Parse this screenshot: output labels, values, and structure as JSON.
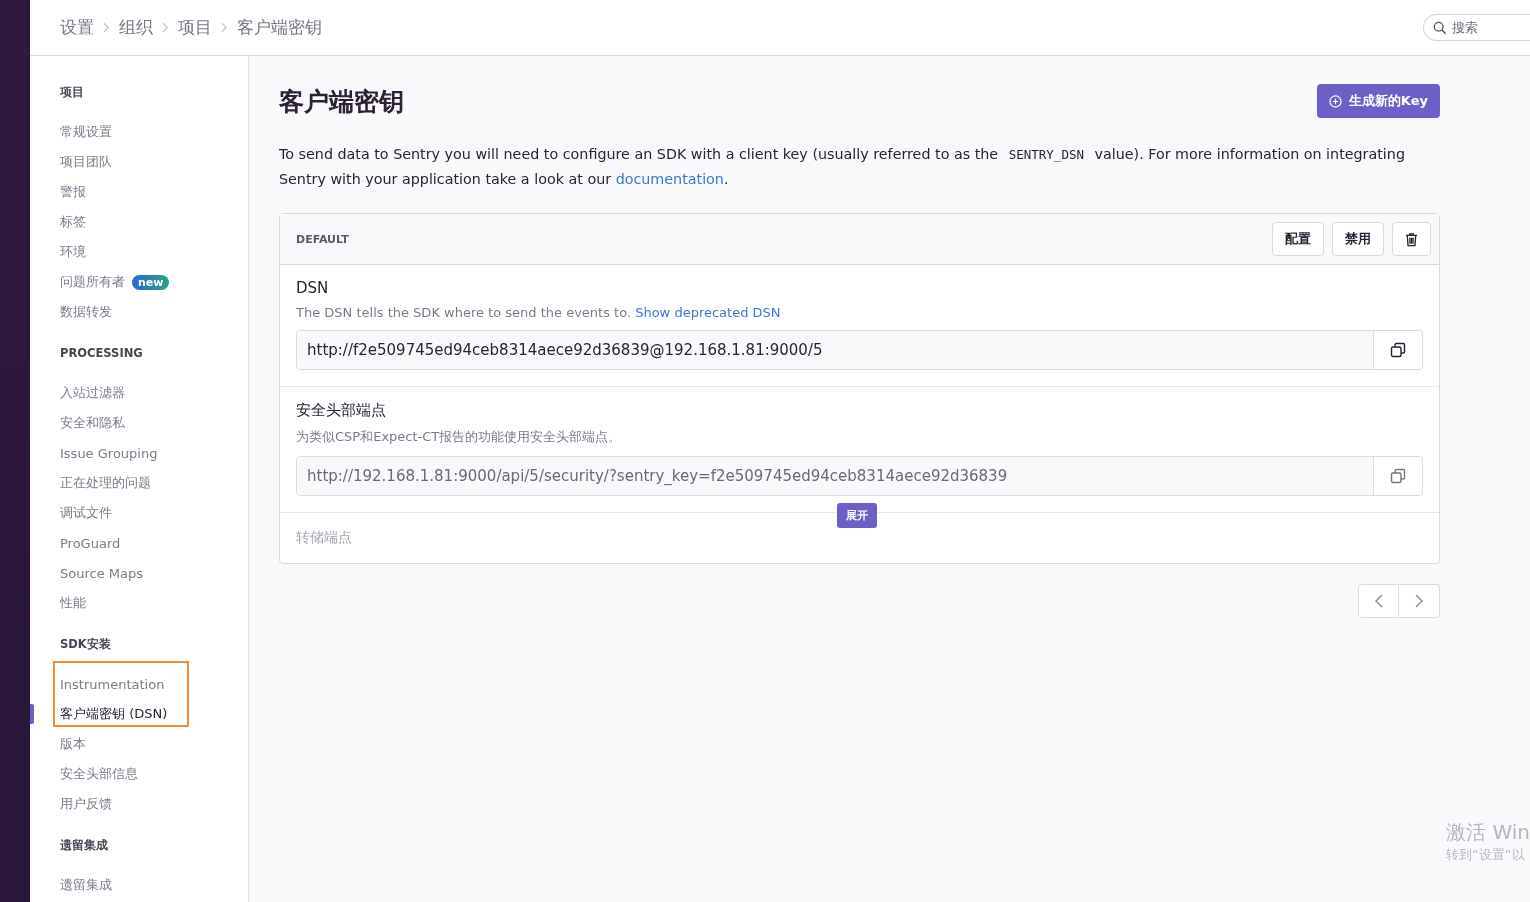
{
  "breadcrumbs": [
    "设置",
    "组织",
    "项目",
    "客户端密钥"
  ],
  "search": {
    "placeholder": "搜索"
  },
  "sidebar": [
    {
      "heading": "项目",
      "items": [
        {
          "label": "常规设置",
          "selected": false
        },
        {
          "label": "项目团队",
          "selected": false
        },
        {
          "label": "警报",
          "selected": false
        },
        {
          "label": "标签",
          "selected": false
        },
        {
          "label": "环境",
          "selected": false
        },
        {
          "label": "问题所有者",
          "selected": false,
          "badge": "new"
        },
        {
          "label": "数据转发",
          "selected": false
        }
      ]
    },
    {
      "heading": "PROCESSING",
      "items": [
        {
          "label": "入站过滤器",
          "selected": false
        },
        {
          "label": "安全和隐私",
          "selected": false
        },
        {
          "label": "Issue Grouping",
          "selected": false
        },
        {
          "label": "正在处理的问题",
          "selected": false
        },
        {
          "label": "调试文件",
          "selected": false
        },
        {
          "label": "ProGuard",
          "selected": false
        },
        {
          "label": "Source Maps",
          "selected": false
        },
        {
          "label": "性能",
          "selected": false
        }
      ]
    },
    {
      "heading": "SDK安装",
      "items": [
        {
          "label": "Instrumentation",
          "selected": false,
          "outlined": true
        },
        {
          "label": "客户端密钥 (DSN)",
          "selected": true,
          "outlined": true
        },
        {
          "label": "版本",
          "selected": false,
          "outlined": false
        },
        {
          "label": "安全头部信息",
          "selected": false,
          "outlined": false
        },
        {
          "label": "用户反馈",
          "selected": false,
          "outlined": false
        }
      ]
    },
    {
      "heading": "遗留集成",
      "items": [
        {
          "label": "遗留集成",
          "selected": false
        }
      ]
    }
  ],
  "page": {
    "title": "客户端密钥",
    "new_key_button": "生成新的Key",
    "intro": "To send data to Sentry you will need to configure an SDK with a client key (usually referred to as the ",
    "intro_code": "SENTRY_DSN",
    "intro_mid": " value). For more information on integrating Sentry with your application take a look at our ",
    "intro_link": "documentation",
    "intro_end": "."
  },
  "key_card": {
    "name": "DEFAULT",
    "buttons": [
      "配置",
      "禁用"
    ],
    "fields": [
      {
        "label": "DSN",
        "help": "The DSN tells the SDK where to send the events to. ",
        "help_link": "Show deprecated DSN",
        "value": "http://f2e509745ed94ceb8314aece92d36839@192.168.1.81:9000/5",
        "muted": false
      },
      {
        "label": "安全头部端点",
        "help": "为类似CSP和Expect-CT报告的功能使用安全头部端点。",
        "value": "http://192.168.1.81:9000/api/5/security/?sentry_key=f2e509745ed94ceb8314aece92d36839",
        "muted": true
      }
    ],
    "collapsed_label": "转储端点",
    "expand_button": "展开"
  },
  "os_notice": [
    "激活 Win",
    "转到“设置”以"
  ]
}
